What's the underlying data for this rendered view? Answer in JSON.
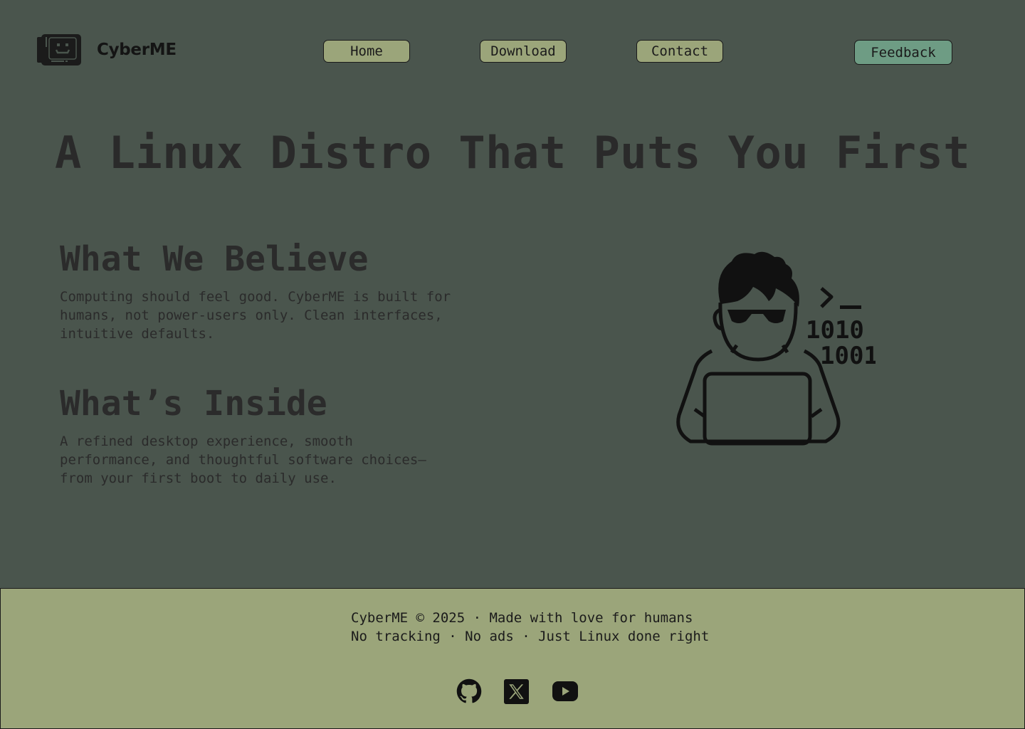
{
  "header": {
    "brand": "CyberME",
    "logo_icon": "smiley-monitor-icon",
    "nav": [
      {
        "label": "Home"
      },
      {
        "label": "Download"
      },
      {
        "label": "Contact"
      }
    ],
    "feedback_label": "Feedback"
  },
  "hero": {
    "title": "A Linux Distro That Puts You First"
  },
  "sections": {
    "believe": {
      "heading": "What We Believe",
      "body": "Computing should feel good. CyberME is built for humans, not power-users only. Clean interfaces, intuitive defaults."
    },
    "inside": {
      "heading": "What’s Inside",
      "body": "A refined desktop experience, smooth performance, and thoughtful software choices—from your first boot to daily use."
    }
  },
  "illustration": {
    "icon": "hacker-at-laptop-icon",
    "binary_line_1": "1010",
    "binary_line_2": "1001"
  },
  "footer": {
    "line1": "CyberME © 2025 · Made with love for humans",
    "line2": "No tracking · No ads · Just Linux done right",
    "social": [
      {
        "icon": "github-icon"
      },
      {
        "icon": "x-twitter-icon"
      },
      {
        "icon": "youtube-icon"
      }
    ]
  },
  "colors": {
    "background": "#4a554d",
    "button": "#9ba57a",
    "feedback_button": "#6e9c84",
    "footer": "#9ba57a",
    "text_dark": "#2b2b2b"
  }
}
